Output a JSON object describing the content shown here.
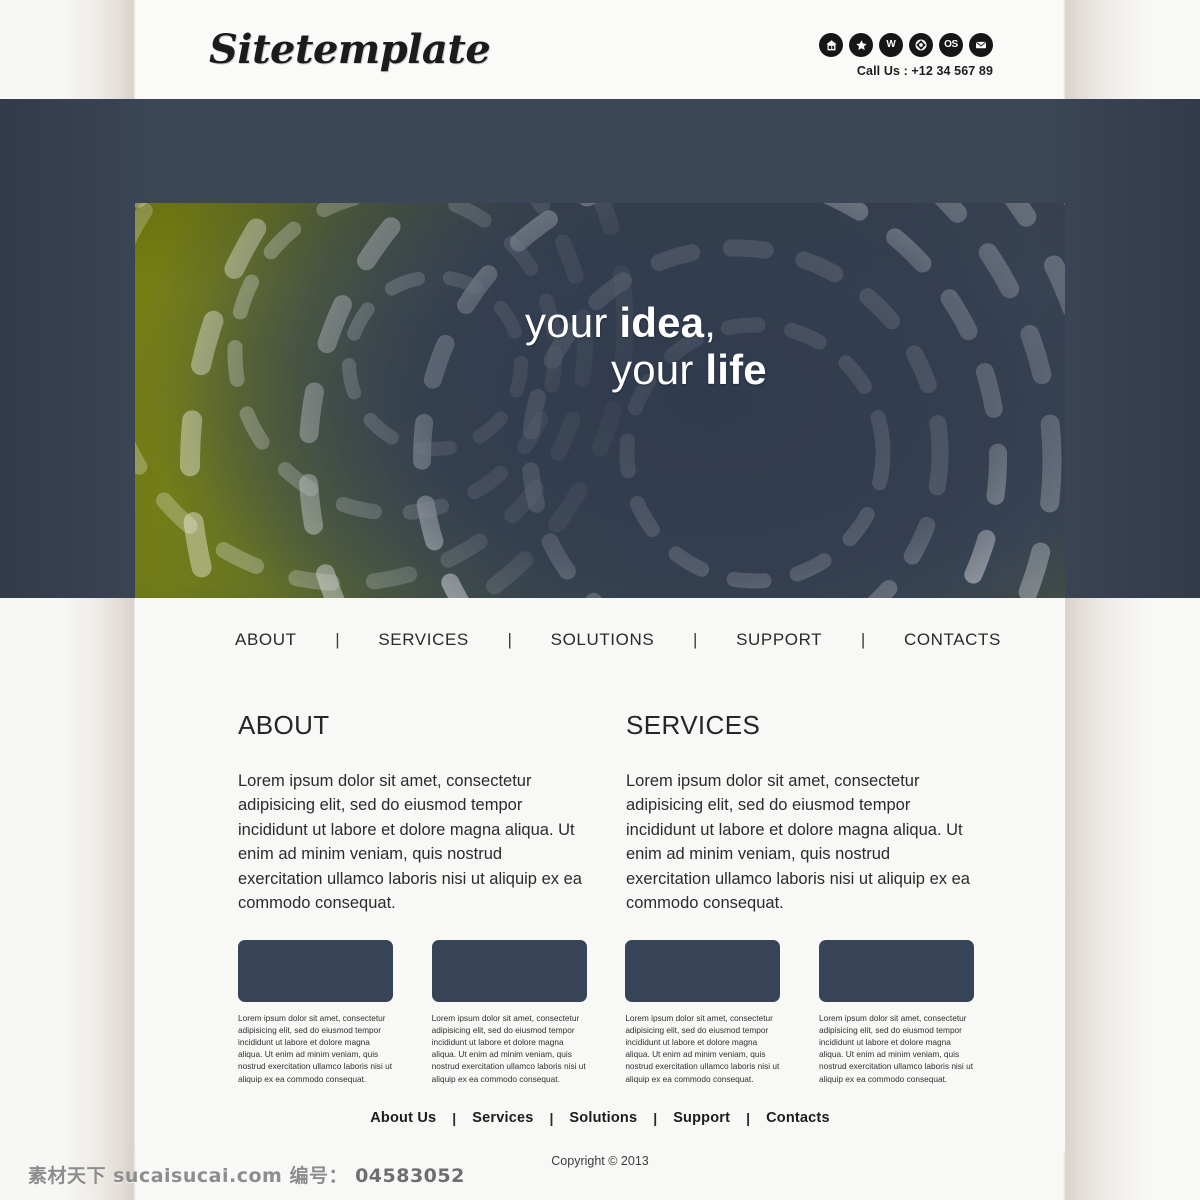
{
  "header": {
    "logo": "Sitetemplate",
    "phone": "Call Us : +12 34 567 89",
    "social": [
      {
        "name": "home-icon",
        "glyph": "home"
      },
      {
        "name": "star-icon",
        "glyph": "star"
      },
      {
        "name": "wordpress-icon",
        "glyph": "W"
      },
      {
        "name": "compass-icon",
        "glyph": "compass"
      },
      {
        "name": "os-icon",
        "glyph": "OS"
      },
      {
        "name": "email-icon",
        "glyph": "envelope"
      }
    ]
  },
  "hero": {
    "line1_light": "your ",
    "line1_bold": "idea",
    "line1_tail": ",",
    "line2_light": "your ",
    "line2_bold": "life"
  },
  "nav": {
    "items": [
      "ABOUT",
      "SERVICES",
      "SOLUTIONS",
      "SUPPORT",
      "CONTACTS"
    ],
    "separator": "|"
  },
  "columns": [
    {
      "heading": "ABOUT",
      "body": "Lorem ipsum dolor sit amet, consectetur adipisicing elit, sed do eiusmod tempor incididunt ut labore et dolore magna aliqua. Ut enim ad minim veniam, quis nostrud exercitation ullamco laboris nisi ut aliquip ex ea commodo consequat."
    },
    {
      "heading": "SERVICES",
      "body": "Lorem ipsum dolor sit amet, consectetur adipisicing elit, sed do eiusmod tempor incididunt ut labore et dolore magna aliqua. Ut enim ad minim veniam, quis nostrud exercitation ullamco laboris nisi ut aliquip ex ea commodo consequat."
    }
  ],
  "thumbs": [
    {
      "caption": "Lorem ipsum dolor sit amet, consectetur adipisicing elit, sed do eiusmod tempor incididunt ut labore et dolore magna aliqua. Ut enim ad minim veniam, quis nostrud exercitation ullamco laboris nisi ut aliquip ex ea commodo consequat."
    },
    {
      "caption": "Lorem ipsum dolor sit amet, consectetur adipisicing elit, sed do eiusmod tempor incididunt ut labore et dolore magna aliqua. Ut enim ad minim veniam, quis nostrud exercitation ullamco laboris nisi ut aliquip ex ea commodo consequat."
    },
    {
      "caption": "Lorem ipsum dolor sit amet, consectetur adipisicing elit, sed do eiusmod tempor incididunt ut labore et dolore magna aliqua. Ut enim ad minim veniam, quis nostrud exercitation ullamco laboris nisi ut aliquip ex ea commodo consequat."
    },
    {
      "caption": "Lorem ipsum dolor sit amet, consectetur adipisicing elit, sed do eiusmod tempor incididunt ut labore et dolore magna aliqua. Ut enim ad minim veniam, quis nostrud exercitation ullamco laboris nisi ut aliquip ex ea commodo consequat."
    }
  ],
  "footer": {
    "links": [
      "About Us",
      "Services",
      "Solutions",
      "Support",
      "Contacts"
    ],
    "separator": "|",
    "copyright": "Copyright © 2013"
  },
  "watermark": {
    "site": "素材天下  sucaisucai.com",
    "label": "编号：",
    "number": "04583052"
  },
  "colors": {
    "navy": "#3b4657",
    "thumb_navy": "#374357",
    "olive": "#6e7a1c",
    "panel_bg": "#f8f8f6",
    "header_bg": "#fafaf8",
    "icon_bg": "#161616",
    "text": "#2a2a2a"
  }
}
